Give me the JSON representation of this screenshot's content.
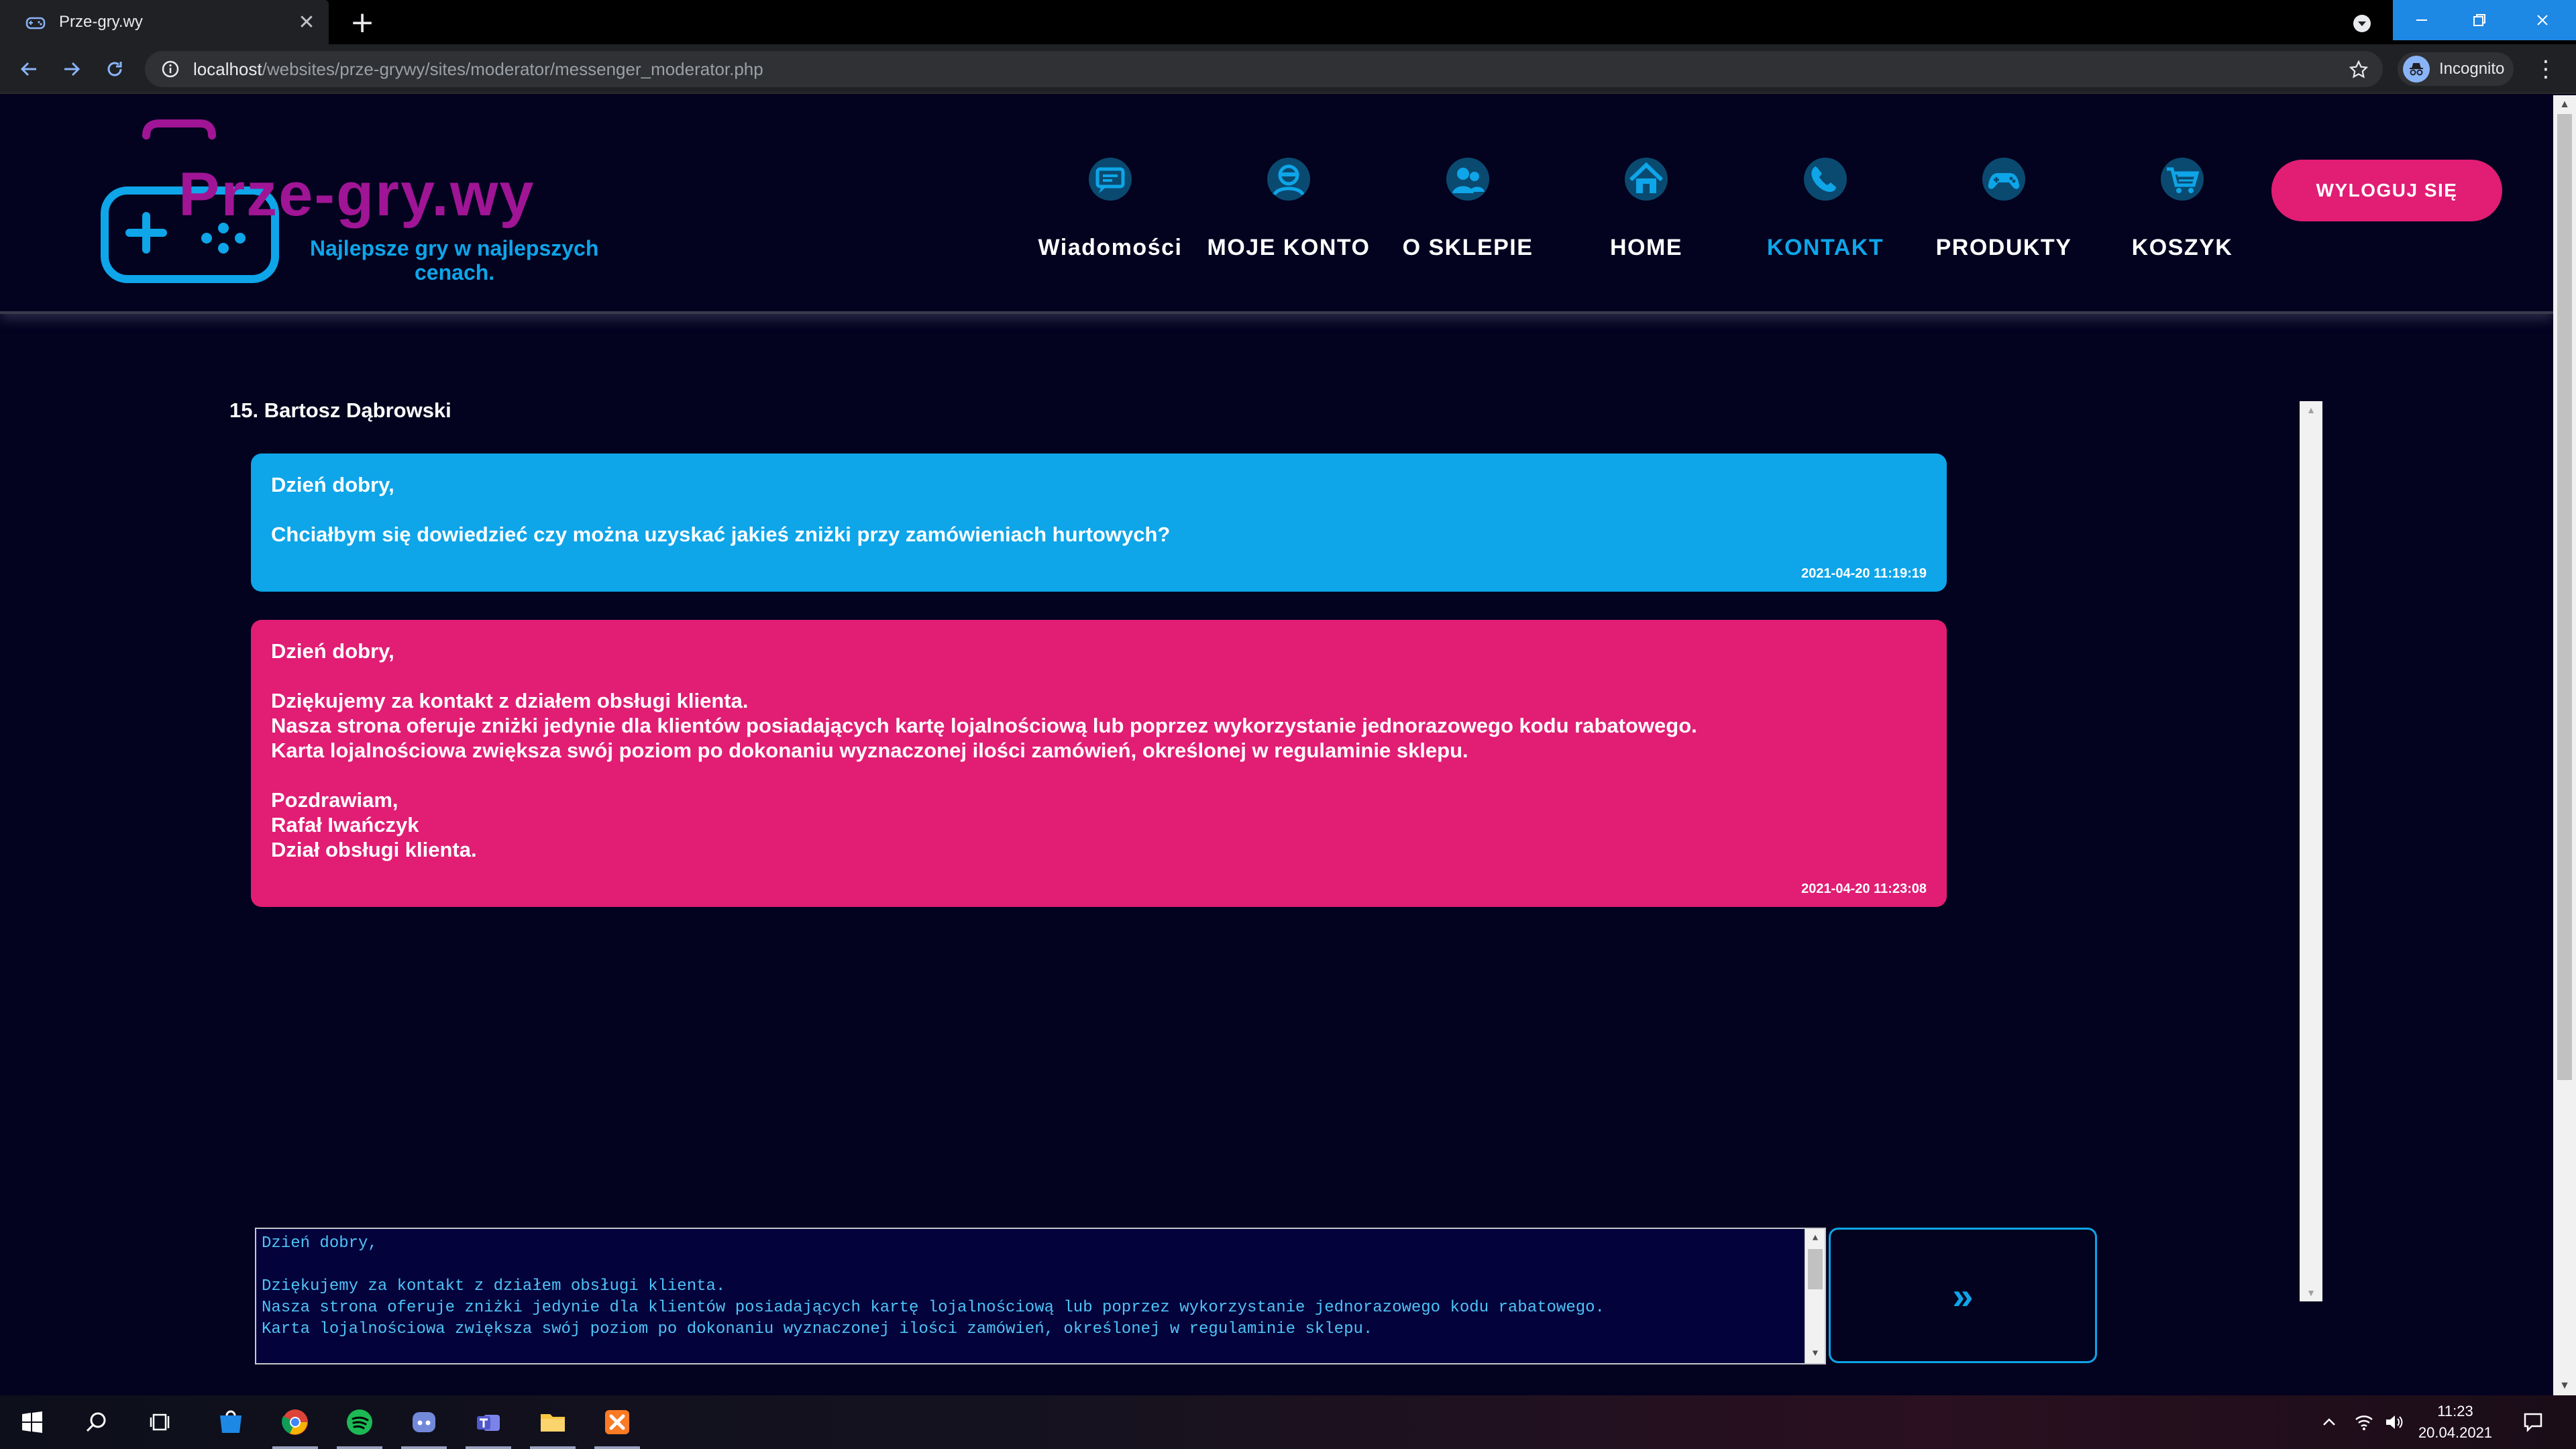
{
  "browser": {
    "tab_title": "Prze-gry.wy",
    "tab_close": "✕",
    "new_tab": "+",
    "url_host": "localhost",
    "url_path": "/websites/prze-grywy/sites/moderator/messenger_moderator.php",
    "profile_label": "Incognito"
  },
  "site": {
    "logo_title": "Prze-gry.wy",
    "logo_tagline_1": "Najlepsze gry w najlepszych",
    "logo_tagline_2": "cenach.",
    "nav": [
      {
        "label": "Wiadomości",
        "icon": "messages-icon"
      },
      {
        "label": "MOJE KONTO",
        "icon": "account-icon"
      },
      {
        "label": "O SKLEPIE",
        "icon": "about-icon"
      },
      {
        "label": "HOME",
        "icon": "home-icon"
      },
      {
        "label": "KONTAKT",
        "icon": "contact-icon",
        "active": true
      },
      {
        "label": "PRODUKTY",
        "icon": "gamepad-icon"
      },
      {
        "label": "KOSZYK",
        "icon": "cart-icon"
      }
    ],
    "logout_label": "WYLOGUJ SIĘ",
    "accent_blue": "#0ea5e9",
    "accent_pink": "#e11d74",
    "background": "#03021f"
  },
  "conversation": {
    "title": "15. Bartosz Dąbrowski",
    "messages": [
      {
        "role": "client",
        "lines": [
          "Dzień dobry,",
          "",
          "Chciałbym się dowiedzieć czy można uzyskać jakieś zniżki przy zamówieniach hurtowych?"
        ],
        "timestamp": "2021-04-20 11:19:19"
      },
      {
        "role": "moderator",
        "lines": [
          "Dzień dobry,",
          "",
          "Dziękujemy za kontakt z działem obsługi klienta.",
          "Nasza strona oferuje zniżki jedynie dla klientów posiadających kartę lojalnościową lub poprzez wykorzystanie jednorazowego kodu rabatowego.",
          "Karta lojalnościowa zwiększa swój poziom po dokonaniu wyznaczonej ilości zamówień, określonej w regulaminie sklepu.",
          "",
          "Pozdrawiam,",
          "Rafał Iwańczyk",
          "Dział obsługi klienta."
        ],
        "timestamp": "2021-04-20 11:23:08"
      }
    ]
  },
  "composer": {
    "lines": [
      "Dzień dobry,",
      "",
      "Dziękujemy za kontakt z działem obsługi klienta.",
      "Nasza strona oferuje zniżki jedynie dla klientów posiadających kartę lojalnościową lub poprzez wykorzystanie jednorazowego kodu rabatowego.",
      "Karta lojalnościowa zwiększa swój poziom po dokonaniu wyznaczonej ilości zamówień, określonej w regulaminie sklepu."
    ],
    "send_label": "»"
  },
  "taskbar": {
    "apps": [
      "windows-start-icon",
      "search-icon",
      "task-view-icon",
      "store-icon",
      "chrome-icon",
      "spotify-icon",
      "discord-icon",
      "teams-icon",
      "file-explorer-icon",
      "xampp-icon"
    ],
    "time": "11:23",
    "date": "20.04.2021"
  }
}
